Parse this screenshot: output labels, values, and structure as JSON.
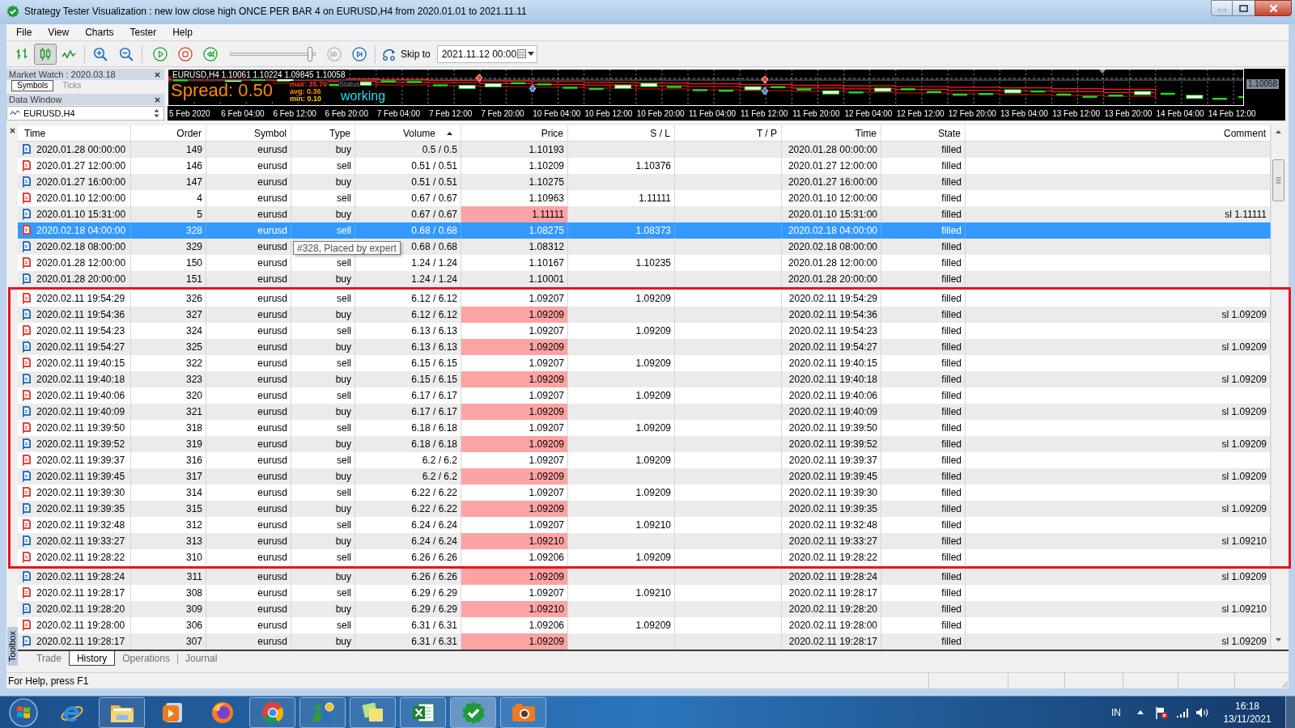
{
  "window": {
    "title": "Strategy Tester Visualization : new low close high ONCE PER BAR 4 on EURUSD,H4 from 2020.01.01 to 2021.11.11"
  },
  "menu": [
    "File",
    "View",
    "Charts",
    "Tester",
    "Help"
  ],
  "toolbar": {
    "chart_modes": [
      {
        "kind": "bars",
        "selected": false
      },
      {
        "kind": "candles",
        "selected": true
      },
      {
        "kind": "line",
        "selected": false
      }
    ],
    "playback": [
      {
        "kind": "play",
        "disabled": false
      },
      {
        "kind": "stop",
        "disabled": false
      },
      {
        "kind": "rewind",
        "disabled": false
      }
    ],
    "speed_slider": {
      "level": 0.97
    },
    "stepping": [
      {
        "kind": "fast_forward",
        "disabled": true
      },
      {
        "kind": "step",
        "disabled": false
      }
    ],
    "skip_to": {
      "label": "Skip to",
      "value": "2021.11.12 00:00"
    }
  },
  "market_watch": {
    "title": "Market Watch : 2020.03.18",
    "tabs": [
      {
        "label": "Symbols",
        "selected": true
      },
      {
        "label": "Ticks",
        "selected": false
      }
    ]
  },
  "data_window": {
    "title": "Data Window",
    "symbol": "EURUSD,H4"
  },
  "chart": {
    "info": "EURUSD,H4 1.10061 1.10224 1.09845 1.10058",
    "spread": "Spread: 0.50",
    "stats": [
      {
        "text": "max: 35.70",
        "color": "#ff3c1e"
      },
      {
        "text": "avg: 0.36",
        "color": "#ff9a00"
      },
      {
        "text": "min: 0.10",
        "color": "#ffd000"
      }
    ],
    "status_label": "Status",
    "status": "working",
    "price_label": "1.10058",
    "time_labels": [
      "5 Feb 2020",
      "6 Feb 04:00",
      "6 Feb 12:00",
      "6 Feb 20:00",
      "7 Feb 04:00",
      "7 Feb 12:00",
      "7 Feb 20:00",
      "10 Feb 04:00",
      "10 Feb 12:00",
      "10 Feb 20:00",
      "11 Feb 04:00",
      "11 Feb 12:00",
      "11 Feb 20:00",
      "12 Feb 04:00",
      "12 Feb 12:00",
      "12 Feb 20:00",
      "13 Feb 04:00",
      "13 Feb 12:00",
      "13 Feb 20:00",
      "14 Feb 04:00",
      "14 Feb 12:00"
    ]
  },
  "table": {
    "columns": [
      {
        "label": "Time",
        "sorted": false
      },
      {
        "label": "Order",
        "sorted": false
      },
      {
        "label": "Symbol",
        "sorted": false
      },
      {
        "label": "Type",
        "sorted": false
      },
      {
        "label": "Volume",
        "sorted": true
      },
      {
        "label": "Price",
        "sorted": false
      },
      {
        "label": "S / L",
        "sorted": false
      },
      {
        "label": "T / P",
        "sorted": false
      },
      {
        "label": "Time",
        "sorted": false
      },
      {
        "label": "State",
        "sorted": false
      },
      {
        "label": "Comment",
        "sorted": false
      }
    ],
    "row_groups": [
      {
        "framed": false,
        "rows": [
          {
            "time": "2020.01.28 00:00:00",
            "order": "149",
            "symbol": "eurusd",
            "type": "buy",
            "volume": "0.5 / 0.5",
            "price": "1.10193",
            "time_done": "2020.01.28 00:00:00",
            "state": "filled",
            "color": "#2f70c0",
            "selected": false,
            "price_highlighted": false
          },
          {
            "time": "2020.01.27 12:00:00",
            "order": "146",
            "symbol": "eurusd",
            "type": "sell",
            "volume": "0.51 / 0.51",
            "price": "1.10209",
            "sl": "1.10376",
            "time_done": "2020.01.27 12:00:00",
            "state": "filled",
            "color": "#e0453a",
            "selected": false,
            "price_highlighted": false
          },
          {
            "time": "2020.01.27 16:00:00",
            "order": "147",
            "symbol": "eurusd",
            "type": "buy",
            "volume": "0.51 / 0.51",
            "price": "1.10275",
            "time_done": "2020.01.27 16:00:00",
            "state": "filled",
            "color": "#2f70c0",
            "selected": false,
            "price_highlighted": false
          },
          {
            "time": "2020.01.10 12:00:00",
            "order": "4",
            "symbol": "eurusd",
            "type": "sell",
            "volume": "0.67 / 0.67",
            "price": "1.10963",
            "sl": "1.11111",
            "time_done": "2020.01.10 12:00:00",
            "state": "filled",
            "color": "#e0453a",
            "selected": false,
            "price_highlighted": false
          },
          {
            "time": "2020.01.10 15:31:00",
            "order": "5",
            "symbol": "eurusd",
            "type": "buy",
            "volume": "0.67 / 0.67",
            "price": "1.11111",
            "time_done": "2020.01.10 15:31:00",
            "state": "filled",
            "comment": "sl 1.11111",
            "color": "#2f70c0",
            "selected": false,
            "price_highlighted": true
          },
          {
            "time": "2020.02.18 04:00:00",
            "order": "328",
            "symbol": "eurusd",
            "type": "sell",
            "volume": "0.68 / 0.68",
            "price": "1.08275",
            "sl": "1.08373",
            "time_done": "2020.02.18 04:00:00",
            "state": "filled",
            "color": "#e0453a",
            "selected": true,
            "price_highlighted": false
          },
          {
            "time": "2020.02.18 08:00:00",
            "order": "329",
            "symbol": "eurusd",
            "volume": "0.68 / 0.68",
            "price": "1.08312",
            "time_done": "2020.02.18 08:00:00",
            "state": "filled",
            "color": "#2f70c0",
            "selected": false,
            "price_highlighted": false
          },
          {
            "time": "2020.01.28 12:00:00",
            "order": "150",
            "symbol": "eurusd",
            "type": "sell",
            "volume": "1.24 / 1.24",
            "price": "1.10167",
            "sl": "1.10235",
            "time_done": "2020.01.28 12:00:00",
            "state": "filled",
            "color": "#e0453a",
            "selected": false,
            "price_highlighted": false
          },
          {
            "time": "2020.01.28 20:00:00",
            "order": "151",
            "symbol": "eurusd",
            "type": "buy",
            "volume": "1.24 / 1.24",
            "price": "1.10001",
            "time_done": "2020.01.28 20:00:00",
            "state": "filled",
            "color": "#2f70c0",
            "selected": false,
            "price_highlighted": false
          }
        ]
      },
      {
        "framed": true,
        "rows": [
          {
            "time": "2020.02.11 19:54:29",
            "order": "326",
            "symbol": "eurusd",
            "type": "sell",
            "volume": "6.12 / 6.12",
            "price": "1.09207",
            "sl": "1.09209",
            "time_done": "2020.02.11 19:54:29",
            "state": "filled",
            "color": "#e0453a",
            "selected": false,
            "price_highlighted": false
          },
          {
            "time": "2020.02.11 19:54:36",
            "order": "327",
            "symbol": "eurusd",
            "type": "buy",
            "volume": "6.12 / 6.12",
            "price": "1.09209",
            "time_done": "2020.02.11 19:54:36",
            "state": "filled",
            "comment": "sl 1.09209",
            "color": "#2f70c0",
            "selected": false,
            "price_highlighted": true
          },
          {
            "time": "2020.02.11 19:54:23",
            "order": "324",
            "symbol": "eurusd",
            "type": "sell",
            "volume": "6.13 / 6.13",
            "price": "1.09207",
            "sl": "1.09209",
            "time_done": "2020.02.11 19:54:23",
            "state": "filled",
            "color": "#e0453a",
            "selected": false,
            "price_highlighted": false
          },
          {
            "time": "2020.02.11 19:54:27",
            "order": "325",
            "symbol": "eurusd",
            "type": "buy",
            "volume": "6.13 / 6.13",
            "price": "1.09209",
            "time_done": "2020.02.11 19:54:27",
            "state": "filled",
            "comment": "sl 1.09209",
            "color": "#2f70c0",
            "selected": false,
            "price_highlighted": true
          },
          {
            "time": "2020.02.11 19:40:15",
            "order": "322",
            "symbol": "eurusd",
            "type": "sell",
            "volume": "6.15 / 6.15",
            "price": "1.09207",
            "sl": "1.09209",
            "time_done": "2020.02.11 19:40:15",
            "state": "filled",
            "color": "#e0453a",
            "selected": false,
            "price_highlighted": false
          },
          {
            "time": "2020.02.11 19:40:18",
            "order": "323",
            "symbol": "eurusd",
            "type": "buy",
            "volume": "6.15 / 6.15",
            "price": "1.09209",
            "time_done": "2020.02.11 19:40:18",
            "state": "filled",
            "comment": "sl 1.09209",
            "color": "#2f70c0",
            "selected": false,
            "price_highlighted": true
          },
          {
            "time": "2020.02.11 19:40:06",
            "order": "320",
            "symbol": "eurusd",
            "type": "sell",
            "volume": "6.17 / 6.17",
            "price": "1.09207",
            "sl": "1.09209",
            "time_done": "2020.02.11 19:40:06",
            "state": "filled",
            "color": "#e0453a",
            "selected": false,
            "price_highlighted": false
          },
          {
            "time": "2020.02.11 19:40:09",
            "order": "321",
            "symbol": "eurusd",
            "type": "buy",
            "volume": "6.17 / 6.17",
            "price": "1.09209",
            "time_done": "2020.02.11 19:40:09",
            "state": "filled",
            "comment": "sl 1.09209",
            "color": "#2f70c0",
            "selected": false,
            "price_highlighted": true
          },
          {
            "time": "2020.02.11 19:39:50",
            "order": "318",
            "symbol": "eurusd",
            "type": "sell",
            "volume": "6.18 / 6.18",
            "price": "1.09207",
            "sl": "1.09209",
            "time_done": "2020.02.11 19:39:50",
            "state": "filled",
            "color": "#e0453a",
            "selected": false,
            "price_highlighted": false
          },
          {
            "time": "2020.02.11 19:39:52",
            "order": "319",
            "symbol": "eurusd",
            "type": "buy",
            "volume": "6.18 / 6.18",
            "price": "1.09209",
            "time_done": "2020.02.11 19:39:52",
            "state": "filled",
            "comment": "sl 1.09209",
            "color": "#2f70c0",
            "selected": false,
            "price_highlighted": true
          },
          {
            "time": "2020.02.11 19:39:37",
            "order": "316",
            "symbol": "eurusd",
            "type": "sell",
            "volume": "6.2 / 6.2",
            "price": "1.09207",
            "sl": "1.09209",
            "time_done": "2020.02.11 19:39:37",
            "state": "filled",
            "color": "#e0453a",
            "selected": false,
            "price_highlighted": false
          },
          {
            "time": "2020.02.11 19:39:45",
            "order": "317",
            "symbol": "eurusd",
            "type": "buy",
            "volume": "6.2 / 6.2",
            "price": "1.09209",
            "time_done": "2020.02.11 19:39:45",
            "state": "filled",
            "comment": "sl 1.09209",
            "color": "#2f70c0",
            "selected": false,
            "price_highlighted": true
          },
          {
            "time": "2020.02.11 19:39:30",
            "order": "314",
            "symbol": "eurusd",
            "type": "sell",
            "volume": "6.22 / 6.22",
            "price": "1.09207",
            "sl": "1.09209",
            "time_done": "2020.02.11 19:39:30",
            "state": "filled",
            "color": "#e0453a",
            "selected": false,
            "price_highlighted": false
          },
          {
            "time": "2020.02.11 19:39:35",
            "order": "315",
            "symbol": "eurusd",
            "type": "buy",
            "volume": "6.22 / 6.22",
            "price": "1.09209",
            "time_done": "2020.02.11 19:39:35",
            "state": "filled",
            "comment": "sl 1.09209",
            "color": "#2f70c0",
            "selected": false,
            "price_highlighted": true
          },
          {
            "time": "2020.02.11 19:32:48",
            "order": "312",
            "symbol": "eurusd",
            "type": "sell",
            "volume": "6.24 / 6.24",
            "price": "1.09207",
            "sl": "1.09210",
            "time_done": "2020.02.11 19:32:48",
            "state": "filled",
            "color": "#e0453a",
            "selected": false,
            "price_highlighted": false
          },
          {
            "time": "2020.02.11 19:33:27",
            "order": "313",
            "symbol": "eurusd",
            "type": "buy",
            "volume": "6.24 / 6.24",
            "price": "1.09210",
            "time_done": "2020.02.11 19:33:27",
            "state": "filled",
            "comment": "sl 1.09210",
            "color": "#2f70c0",
            "selected": false,
            "price_highlighted": true
          },
          {
            "time": "2020.02.11 19:28:22",
            "order": "310",
            "symbol": "eurusd",
            "type": "sell",
            "volume": "6.26 / 6.26",
            "price": "1.09206",
            "sl": "1.09209",
            "time_done": "2020.02.11 19:28:22",
            "state": "filled",
            "color": "#e0453a",
            "selected": false,
            "price_highlighted": false
          }
        ]
      },
      {
        "framed": false,
        "rows": [
          {
            "time": "2020.02.11 19:28:24",
            "order": "311",
            "symbol": "eurusd",
            "type": "buy",
            "volume": "6.26 / 6.26",
            "price": "1.09209",
            "time_done": "2020.02.11 19:28:24",
            "state": "filled",
            "comment": "sl 1.09209",
            "color": "#2f70c0",
            "selected": false,
            "price_highlighted": true
          },
          {
            "time": "2020.02.11 19:28:17",
            "order": "308",
            "symbol": "eurusd",
            "type": "sell",
            "volume": "6.29 / 6.29",
            "price": "1.09207",
            "sl": "1.09210",
            "time_done": "2020.02.11 19:28:17",
            "state": "filled",
            "color": "#e0453a",
            "selected": false,
            "price_highlighted": false
          },
          {
            "time": "2020.02.11 19:28:20",
            "order": "309",
            "symbol": "eurusd",
            "type": "buy",
            "volume": "6.29 / 6.29",
            "price": "1.09210",
            "time_done": "2020.02.11 19:28:20",
            "state": "filled",
            "comment": "sl 1.09210",
            "color": "#2f70c0",
            "selected": false,
            "price_highlighted": true
          },
          {
            "time": "2020.02.11 19:28:00",
            "order": "306",
            "symbol": "eurusd",
            "type": "sell",
            "volume": "6.31 / 6.31",
            "price": "1.09206",
            "sl": "1.09209",
            "time_done": "2020.02.11 19:28:00",
            "state": "filled",
            "color": "#e0453a",
            "selected": false,
            "price_highlighted": false
          },
          {
            "time": "2020.02.11 19:28:17",
            "order": "307",
            "symbol": "eurusd",
            "type": "buy",
            "volume": "6.31 / 6.31",
            "price": "1.09209",
            "time_done": "2020.02.11 19:28:17",
            "state": "filled",
            "comment": "sl 1.09209",
            "color": "#2f70c0",
            "selected": false,
            "price_highlighted": true
          }
        ]
      }
    ],
    "tooltip": "#328, Placed by expert"
  },
  "toolbox": {
    "label": "Toolbox"
  },
  "bottom_tabs": [
    {
      "label": "Trade",
      "selected": false
    },
    {
      "label": "History",
      "selected": true
    },
    {
      "label": "Operations",
      "selected": false
    },
    {
      "label": "Journal",
      "selected": false
    }
  ],
  "status_bar": {
    "text": "For Help, press F1"
  },
  "taskbar": {
    "apps": [
      {
        "kind": "browser",
        "running": false,
        "active": false
      },
      {
        "kind": "folder",
        "running": true,
        "active": false
      },
      {
        "kind": "media",
        "running": false,
        "active": false
      },
      {
        "kind": "fox",
        "running": false,
        "active": false
      },
      {
        "kind": "ring",
        "running": true,
        "active": false
      },
      {
        "kind": "trader",
        "running": true,
        "active": false
      },
      {
        "kind": "notes",
        "running": true,
        "active": false
      },
      {
        "kind": "sheet",
        "running": true,
        "active": false
      },
      {
        "kind": "check",
        "running": true,
        "active": true
      },
      {
        "kind": "camera",
        "running": true,
        "active": false
      }
    ],
    "language": "IN",
    "time": "16:18",
    "date": "13/11/2021"
  }
}
